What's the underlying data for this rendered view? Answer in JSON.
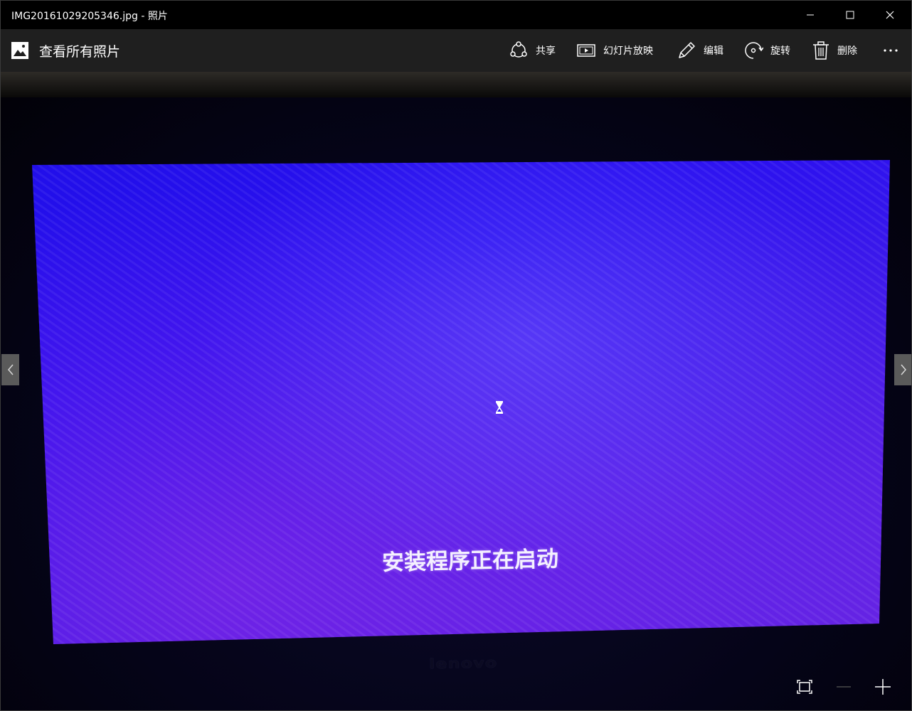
{
  "window": {
    "title": "IMG20161029205346.jpg - 照片",
    "controls": {
      "minimize_icon": "minimize-icon",
      "maximize_icon": "maximize-icon",
      "close_icon": "close-icon"
    }
  },
  "commandbar": {
    "back_label": "查看所有照片",
    "back_icon": "photo-gallery-icon",
    "share_label": "共享",
    "slideshow_label": "幻灯片放映",
    "edit_label": "编辑",
    "rotate_label": "旋转",
    "delete_label": "删除",
    "more_icon": "more-ellipsis-icon"
  },
  "photo": {
    "screen_text": "安装程序正在启动",
    "brand_text": "lenovo",
    "colors": {
      "screen_blue": "#2a10f0",
      "screen_purple": "#6a24dc"
    }
  },
  "navigation": {
    "prev_icon": "chevron-left-icon",
    "next_icon": "chevron-right-icon"
  },
  "zoom": {
    "fit_icon": "fit-to-window-icon",
    "zoom_out_icon": "minus-icon",
    "zoom_in_icon": "plus-icon",
    "zoom_out_enabled": false
  }
}
